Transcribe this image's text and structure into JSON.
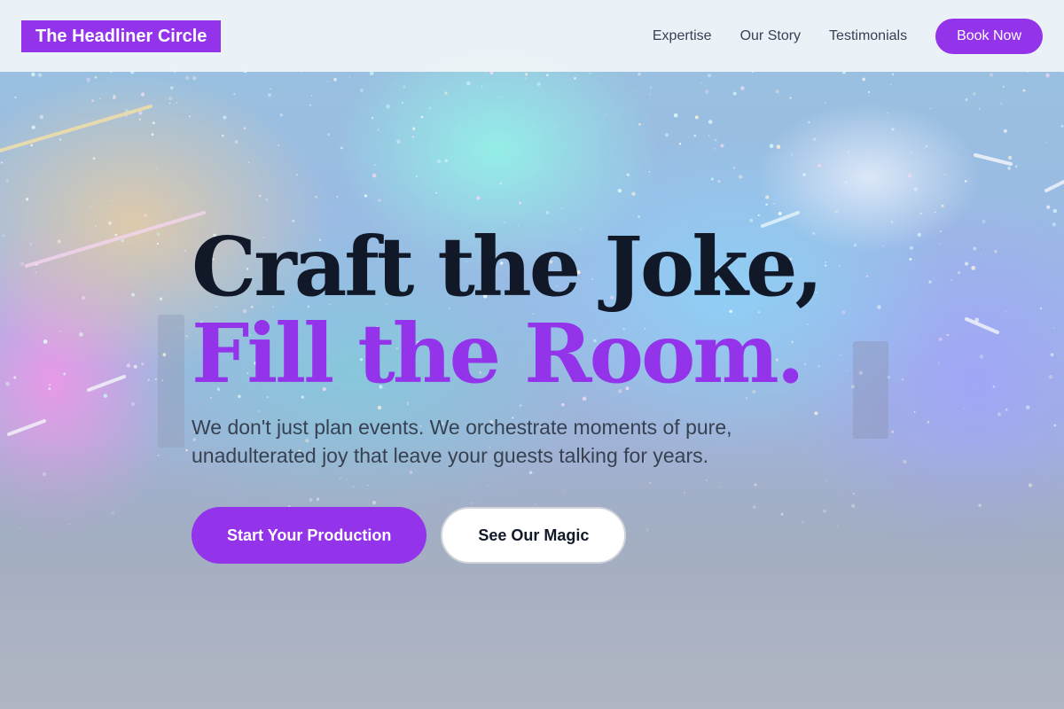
{
  "header": {
    "logo": "The Headliner Circle",
    "nav": [
      {
        "label": "Expertise"
      },
      {
        "label": "Our Story"
      },
      {
        "label": "Testimonials"
      }
    ],
    "cta_label": "Book Now"
  },
  "hero": {
    "headline_line1": "Craft the Joke,",
    "headline_line2": "Fill the Room.",
    "subtext": "We don't just plan events. We orchestrate moments of pure, unadulterated joy that leave your guests talking for years.",
    "primary_cta": "Start Your Production",
    "secondary_cta": "See Our Magic"
  },
  "colors": {
    "accent": "#9333ea",
    "headline_dark": "#111827",
    "body_text": "#374151",
    "header_bg": "#f1f5f9"
  }
}
